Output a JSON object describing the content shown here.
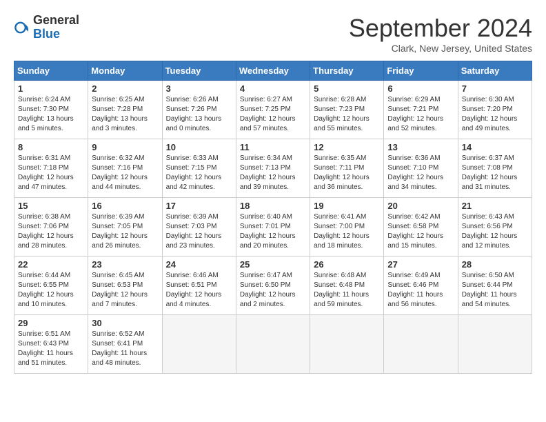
{
  "header": {
    "logo_general": "General",
    "logo_blue": "Blue",
    "month_title": "September 2024",
    "location": "Clark, New Jersey, United States"
  },
  "days_of_week": [
    "Sunday",
    "Monday",
    "Tuesday",
    "Wednesday",
    "Thursday",
    "Friday",
    "Saturday"
  ],
  "weeks": [
    [
      {
        "day": 1,
        "sunrise": "Sunrise: 6:24 AM",
        "sunset": "Sunset: 7:30 PM",
        "daylight": "Daylight: 13 hours and 5 minutes."
      },
      {
        "day": 2,
        "sunrise": "Sunrise: 6:25 AM",
        "sunset": "Sunset: 7:28 PM",
        "daylight": "Daylight: 13 hours and 3 minutes."
      },
      {
        "day": 3,
        "sunrise": "Sunrise: 6:26 AM",
        "sunset": "Sunset: 7:26 PM",
        "daylight": "Daylight: 13 hours and 0 minutes."
      },
      {
        "day": 4,
        "sunrise": "Sunrise: 6:27 AM",
        "sunset": "Sunset: 7:25 PM",
        "daylight": "Daylight: 12 hours and 57 minutes."
      },
      {
        "day": 5,
        "sunrise": "Sunrise: 6:28 AM",
        "sunset": "Sunset: 7:23 PM",
        "daylight": "Daylight: 12 hours and 55 minutes."
      },
      {
        "day": 6,
        "sunrise": "Sunrise: 6:29 AM",
        "sunset": "Sunset: 7:21 PM",
        "daylight": "Daylight: 12 hours and 52 minutes."
      },
      {
        "day": 7,
        "sunrise": "Sunrise: 6:30 AM",
        "sunset": "Sunset: 7:20 PM",
        "daylight": "Daylight: 12 hours and 49 minutes."
      }
    ],
    [
      {
        "day": 8,
        "sunrise": "Sunrise: 6:31 AM",
        "sunset": "Sunset: 7:18 PM",
        "daylight": "Daylight: 12 hours and 47 minutes."
      },
      {
        "day": 9,
        "sunrise": "Sunrise: 6:32 AM",
        "sunset": "Sunset: 7:16 PM",
        "daylight": "Daylight: 12 hours and 44 minutes."
      },
      {
        "day": 10,
        "sunrise": "Sunrise: 6:33 AM",
        "sunset": "Sunset: 7:15 PM",
        "daylight": "Daylight: 12 hours and 42 minutes."
      },
      {
        "day": 11,
        "sunrise": "Sunrise: 6:34 AM",
        "sunset": "Sunset: 7:13 PM",
        "daylight": "Daylight: 12 hours and 39 minutes."
      },
      {
        "day": 12,
        "sunrise": "Sunrise: 6:35 AM",
        "sunset": "Sunset: 7:11 PM",
        "daylight": "Daylight: 12 hours and 36 minutes."
      },
      {
        "day": 13,
        "sunrise": "Sunrise: 6:36 AM",
        "sunset": "Sunset: 7:10 PM",
        "daylight": "Daylight: 12 hours and 34 minutes."
      },
      {
        "day": 14,
        "sunrise": "Sunrise: 6:37 AM",
        "sunset": "Sunset: 7:08 PM",
        "daylight": "Daylight: 12 hours and 31 minutes."
      }
    ],
    [
      {
        "day": 15,
        "sunrise": "Sunrise: 6:38 AM",
        "sunset": "Sunset: 7:06 PM",
        "daylight": "Daylight: 12 hours and 28 minutes."
      },
      {
        "day": 16,
        "sunrise": "Sunrise: 6:39 AM",
        "sunset": "Sunset: 7:05 PM",
        "daylight": "Daylight: 12 hours and 26 minutes."
      },
      {
        "day": 17,
        "sunrise": "Sunrise: 6:39 AM",
        "sunset": "Sunset: 7:03 PM",
        "daylight": "Daylight: 12 hours and 23 minutes."
      },
      {
        "day": 18,
        "sunrise": "Sunrise: 6:40 AM",
        "sunset": "Sunset: 7:01 PM",
        "daylight": "Daylight: 12 hours and 20 minutes."
      },
      {
        "day": 19,
        "sunrise": "Sunrise: 6:41 AM",
        "sunset": "Sunset: 7:00 PM",
        "daylight": "Daylight: 12 hours and 18 minutes."
      },
      {
        "day": 20,
        "sunrise": "Sunrise: 6:42 AM",
        "sunset": "Sunset: 6:58 PM",
        "daylight": "Daylight: 12 hours and 15 minutes."
      },
      {
        "day": 21,
        "sunrise": "Sunrise: 6:43 AM",
        "sunset": "Sunset: 6:56 PM",
        "daylight": "Daylight: 12 hours and 12 minutes."
      }
    ],
    [
      {
        "day": 22,
        "sunrise": "Sunrise: 6:44 AM",
        "sunset": "Sunset: 6:55 PM",
        "daylight": "Daylight: 12 hours and 10 minutes."
      },
      {
        "day": 23,
        "sunrise": "Sunrise: 6:45 AM",
        "sunset": "Sunset: 6:53 PM",
        "daylight": "Daylight: 12 hours and 7 minutes."
      },
      {
        "day": 24,
        "sunrise": "Sunrise: 6:46 AM",
        "sunset": "Sunset: 6:51 PM",
        "daylight": "Daylight: 12 hours and 4 minutes."
      },
      {
        "day": 25,
        "sunrise": "Sunrise: 6:47 AM",
        "sunset": "Sunset: 6:50 PM",
        "daylight": "Daylight: 12 hours and 2 minutes."
      },
      {
        "day": 26,
        "sunrise": "Sunrise: 6:48 AM",
        "sunset": "Sunset: 6:48 PM",
        "daylight": "Daylight: 11 hours and 59 minutes."
      },
      {
        "day": 27,
        "sunrise": "Sunrise: 6:49 AM",
        "sunset": "Sunset: 6:46 PM",
        "daylight": "Daylight: 11 hours and 56 minutes."
      },
      {
        "day": 28,
        "sunrise": "Sunrise: 6:50 AM",
        "sunset": "Sunset: 6:44 PM",
        "daylight": "Daylight: 11 hours and 54 minutes."
      }
    ],
    [
      {
        "day": 29,
        "sunrise": "Sunrise: 6:51 AM",
        "sunset": "Sunset: 6:43 PM",
        "daylight": "Daylight: 11 hours and 51 minutes."
      },
      {
        "day": 30,
        "sunrise": "Sunrise: 6:52 AM",
        "sunset": "Sunset: 6:41 PM",
        "daylight": "Daylight: 11 hours and 48 minutes."
      },
      null,
      null,
      null,
      null,
      null
    ]
  ]
}
